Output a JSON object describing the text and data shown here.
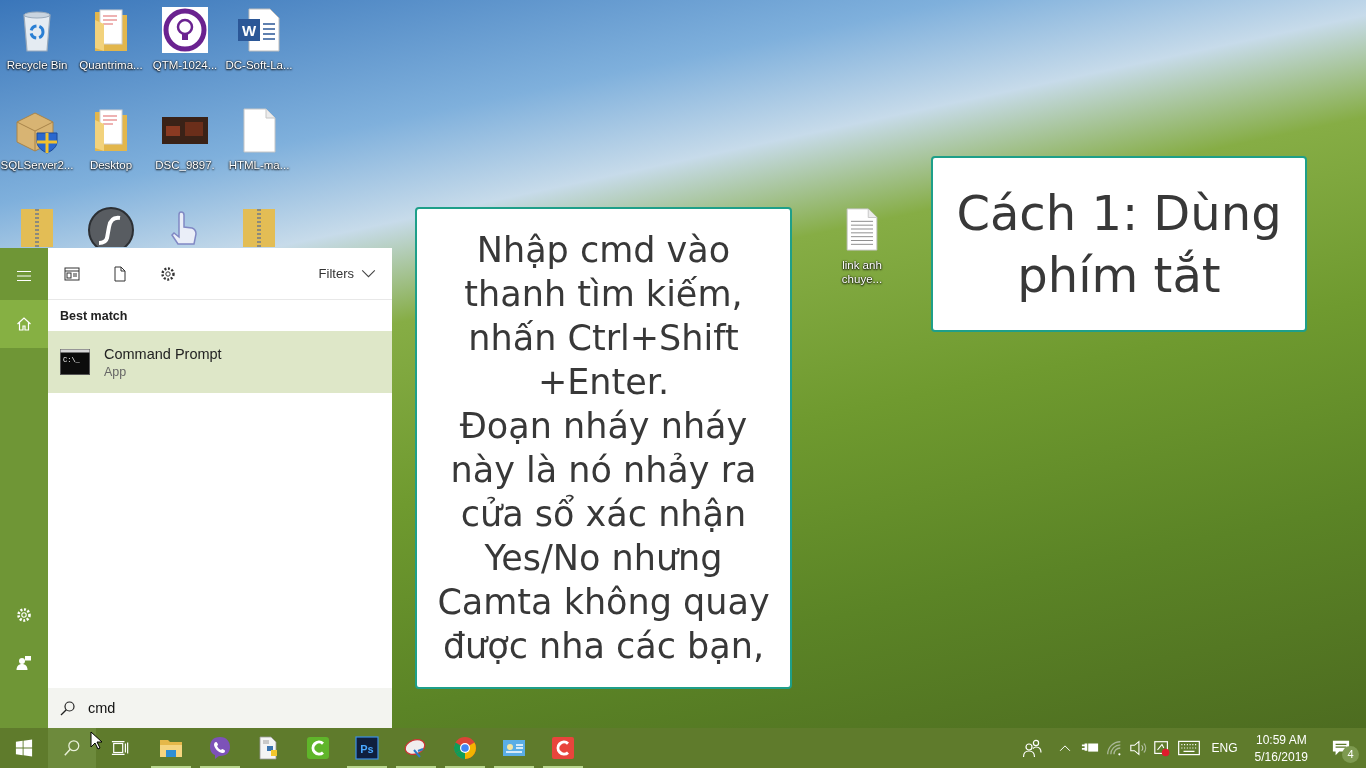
{
  "desktop": {
    "icons": [
      {
        "label": "Recycle Bin",
        "kind": "recycle"
      },
      {
        "label": "Quantrima...",
        "kind": "folder"
      },
      {
        "label": "QTM-1024...",
        "kind": "bulb"
      },
      {
        "label": "DC-Soft-La...",
        "kind": "word",
        "glyph": "W"
      },
      {
        "label": "SQLServer2...",
        "kind": "installer"
      },
      {
        "label": "Desktop",
        "kind": "folder"
      },
      {
        "label": "DSC_9897.",
        "kind": "photo"
      },
      {
        "label": "HTML-ma...",
        "kind": "file"
      },
      {
        "kind": "zip"
      },
      {
        "kind": "flash"
      },
      {
        "kind": "hand"
      },
      {
        "kind": "zip"
      }
    ],
    "loose_icon": {
      "label": "link anh chuye...",
      "kind": "text"
    }
  },
  "instruction_card": {
    "text": "Nhập cmd vào\nthanh tìm kiếm,\nnhấn Ctrl+Shift\n+Enter.\nĐoạn nháy nháy\nnày là nó nhảy ra\ncửa sổ xác nhận\nYes/No nhưng\nCamta không quay\nđược nha các bạn,"
  },
  "title_card": {
    "text": "Cách 1: Dùng\nphím tắt"
  },
  "start_menu": {
    "rail_top": [
      {
        "kind": "menu",
        "selected": false
      },
      {
        "kind": "home",
        "selected": true
      }
    ],
    "rail_bottom": [
      {
        "kind": "settings",
        "selected": false
      },
      {
        "kind": "user",
        "selected": false
      }
    ],
    "toolbar": [
      {
        "kind": "apps"
      },
      {
        "kind": "documents"
      },
      {
        "kind": "settings"
      }
    ],
    "filters": {
      "label": "Filters"
    },
    "section": "Best match",
    "results": [
      {
        "title": "Command Prompt",
        "subtitle": "App",
        "glyph": "C:\\_",
        "selected": true
      }
    ],
    "search": {
      "value": "cmd"
    }
  },
  "taskbar": {
    "buttons": [
      {
        "kind": "start",
        "selected": false
      },
      {
        "kind": "search",
        "selected": true
      },
      {
        "kind": "taskview",
        "selected": false
      }
    ],
    "apps": [
      {
        "kind": "folder",
        "running": true
      },
      {
        "kind": "viber",
        "running": true
      },
      {
        "kind": "python",
        "running": false
      },
      {
        "kind": "cgreen",
        "running": false
      },
      {
        "kind": "ps",
        "glyph": "Ps",
        "running": true
      },
      {
        "kind": "dish",
        "running": true
      },
      {
        "kind": "browser",
        "running": true
      },
      {
        "kind": "card",
        "running": true
      },
      {
        "kind": "cred",
        "running": true
      }
    ],
    "tray": [
      {
        "kind": "people"
      },
      {
        "kind": "chevron"
      },
      {
        "kind": "battery"
      },
      {
        "kind": "wifi"
      },
      {
        "kind": "volume"
      },
      {
        "kind": "alert"
      },
      {
        "kind": "keyboard"
      }
    ],
    "language": "ENG",
    "time": "10:59 AM",
    "date": "5/16/2019",
    "notifications": {
      "count": "4"
    }
  }
}
